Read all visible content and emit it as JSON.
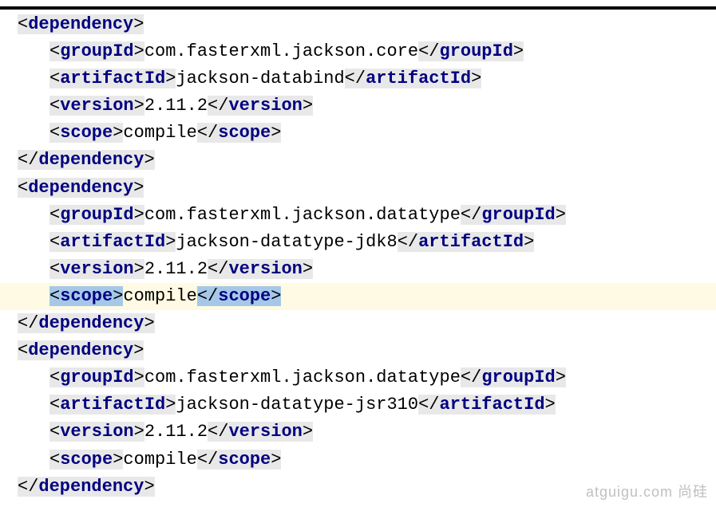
{
  "dependencies": [
    {
      "groupId": "com.fasterxml.jackson.core",
      "artifactId": "jackson-databind",
      "version": "2.11.2",
      "scope": "compile"
    },
    {
      "groupId": "com.fasterxml.jackson.datatype",
      "artifactId": "jackson-datatype-jdk8",
      "version": "2.11.2",
      "scope": "compile"
    },
    {
      "groupId": "com.fasterxml.jackson.datatype",
      "artifactId": "jackson-datatype-jsr310",
      "version": "2.11.2",
      "scope": "compile"
    }
  ],
  "tags": {
    "dependency_open": "dependency",
    "dependency_close": "dependency",
    "groupId_open": "groupId",
    "groupId_close": "groupId",
    "artifactId_open": "artifactId",
    "artifactId_close": "artifactId",
    "version_open": "version",
    "version_close": "version",
    "scope_open": "scope",
    "scope_close": "scope"
  },
  "watermark": "atguigu.com 尚硅"
}
